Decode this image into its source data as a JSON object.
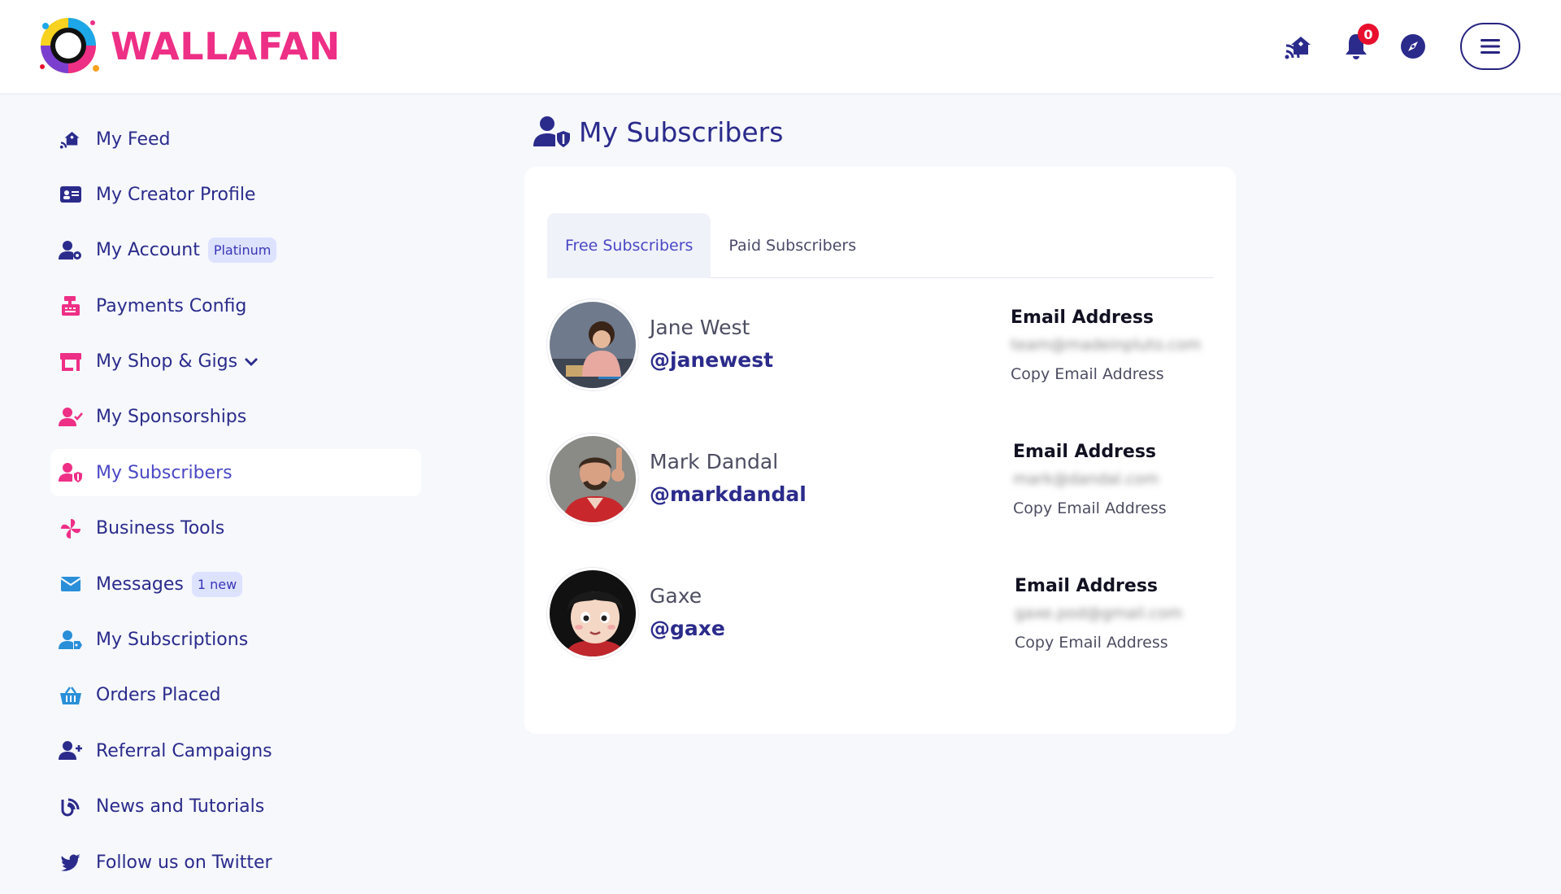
{
  "header": {
    "brand": "WALLAFAN",
    "notification_count": "0",
    "icons": [
      "feed-icon",
      "bell-icon",
      "compass-icon",
      "hamburger-menu-icon"
    ]
  },
  "sidebar": {
    "items": [
      {
        "label": "My Feed",
        "icon": "feed-icon",
        "color": "#2b2b8c"
      },
      {
        "label": "My Creator Profile",
        "icon": "id-card-icon",
        "color": "#2b2b8c"
      },
      {
        "label": "My Account",
        "icon": "user-gear-icon",
        "color": "#2b2b8c",
        "badge": "Platinum"
      },
      {
        "label": "Payments Config",
        "icon": "cash-register-icon",
        "color": "#ee2f86"
      },
      {
        "label": "My Shop & Gigs",
        "icon": "shop-icon",
        "color": "#ee2f86"
      },
      {
        "label": "My Sponsorships",
        "icon": "user-check-icon",
        "color": "#ee2f86"
      },
      {
        "label": "My Subscribers",
        "icon": "user-shield-icon",
        "color": "#ee2f86"
      },
      {
        "label": "Business Tools",
        "icon": "pinwheel-icon",
        "color": "#ee2f86"
      },
      {
        "label": "Messages",
        "icon": "envelope-icon",
        "color": "#2a8fd8",
        "badge": "1 new"
      },
      {
        "label": "My Subscriptions",
        "icon": "user-tag-icon",
        "color": "#2a8fd8"
      },
      {
        "label": "Orders Placed",
        "icon": "basket-icon",
        "color": "#2a8fd8"
      },
      {
        "label": "Referral Campaigns",
        "icon": "user-plus-icon",
        "color": "#2b2b8c"
      },
      {
        "label": "News and Tutorials",
        "icon": "blog-icon",
        "color": "#2b2b8c"
      },
      {
        "label": "Follow us on Twitter",
        "icon": "twitter-icon",
        "color": "#2b2b8c"
      }
    ],
    "active_index": 6
  },
  "main": {
    "title": "My Subscribers",
    "tabs": [
      "Free Subscribers",
      "Paid Subscribers"
    ],
    "active_tab": 0,
    "subscribers": [
      {
        "name": "Jane West",
        "handle": "@janewest",
        "email_label": "Email Address",
        "email": "team@madeinpluto.com",
        "copy_label": "Copy Email Address"
      },
      {
        "name": "Mark Dandal",
        "handle": "@markdandal",
        "email_label": "Email Address",
        "email": "mark@dandal.com",
        "copy_label": "Copy Email Address"
      },
      {
        "name": "Gaxe",
        "handle": "@gaxe",
        "email_label": "Email Address",
        "email": "gaxe.pod@gmail.com",
        "copy_label": "Copy Email Address"
      }
    ]
  },
  "colors": {
    "brand_pink": "#ee2f86",
    "navy": "#2b2b8c",
    "accent_blue": "#4a47c6",
    "badge_red": "#e8102e"
  }
}
